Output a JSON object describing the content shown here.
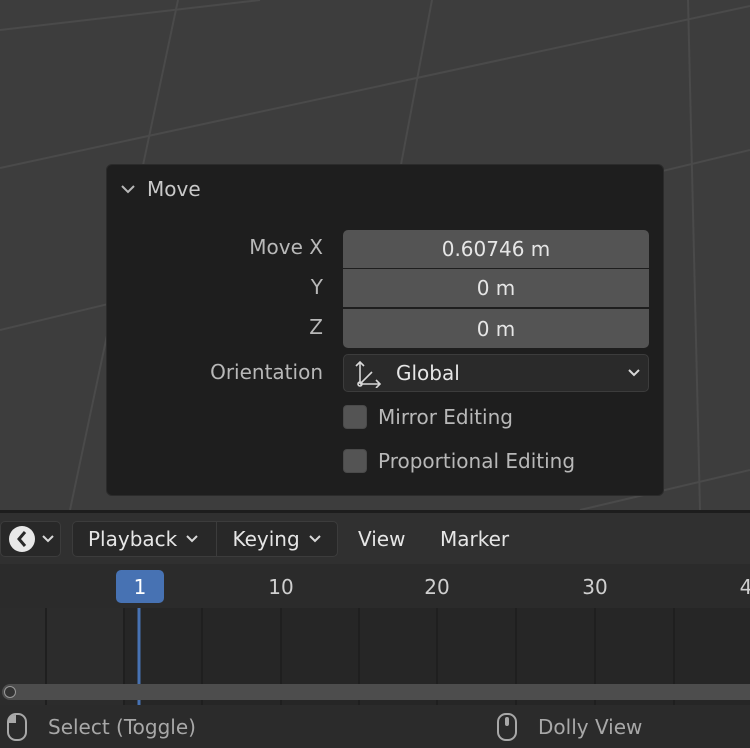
{
  "operator_panel": {
    "title": "Move",
    "rows": {
      "move_x": {
        "label": "Move X",
        "value": "0.60746 m"
      },
      "y": {
        "label": "Y",
        "value": "0 m"
      },
      "z": {
        "label": "Z",
        "value": "0 m"
      }
    },
    "orientation": {
      "label": "Orientation",
      "value": "Global"
    },
    "mirror_editing": {
      "label": "Mirror Editing",
      "checked": false
    },
    "proportional_editing": {
      "label": "Proportional Editing",
      "checked": false
    }
  },
  "timeline": {
    "editor_type_icon": "clock-icon",
    "menus": {
      "playback": "Playback",
      "keying": "Keying",
      "view": "View",
      "marker": "Marker"
    },
    "ticks": [
      "10",
      "20",
      "30",
      "4"
    ],
    "current_frame": "1"
  },
  "status_bar": {
    "left_action": "Select (Toggle)",
    "right_action": "Dolly View"
  },
  "colors": {
    "accent": "#4772b3",
    "panel_bg": "#1e1e1e",
    "field_bg": "#545454",
    "viewport_bg": "#3d3d3d"
  }
}
